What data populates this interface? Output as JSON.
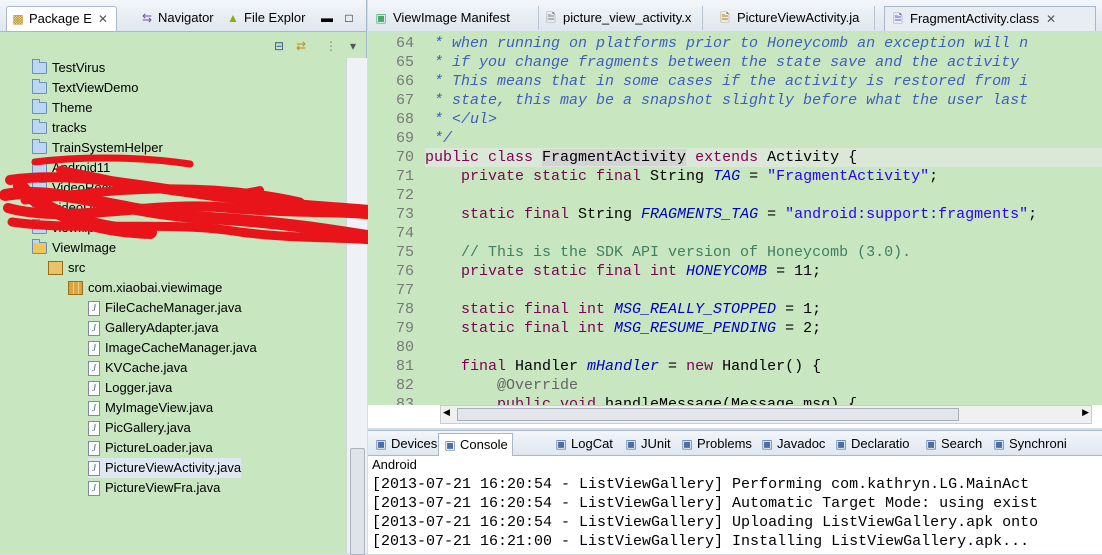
{
  "explorer": {
    "tabs": [
      {
        "label": "Package E",
        "icon": "package-explorer-icon"
      },
      {
        "label": "Navigator",
        "icon": "navigator-icon"
      },
      {
        "label": "File Explor",
        "icon": "android-icon"
      }
    ],
    "tree": [
      {
        "label": "TestVirus",
        "type": "folder",
        "indent": 0
      },
      {
        "label": "TextViewDemo",
        "type": "folder",
        "indent": 0
      },
      {
        "label": "Theme",
        "type": "folder",
        "indent": 0
      },
      {
        "label": "tracks",
        "type": "folder",
        "indent": 0
      },
      {
        "label": "TrainSystemHelper",
        "type": "folder",
        "indent": 0
      },
      {
        "label": "Android11",
        "type": "folder",
        "indent": 0
      },
      {
        "label": "VideoRecoder",
        "type": "folder",
        "indent": 0
      },
      {
        "label": "videoUpload",
        "type": "folder",
        "indent": 0
      },
      {
        "label": "viewflip",
        "type": "folder",
        "indent": 0
      },
      {
        "label": "ViewImage",
        "type": "project",
        "indent": 0
      },
      {
        "label": "src",
        "type": "src",
        "indent": 1
      },
      {
        "label": "com.xiaobai.viewimage",
        "type": "package",
        "indent": 2
      },
      {
        "label": "FileCacheManager.java",
        "type": "java",
        "indent": 3
      },
      {
        "label": "GalleryAdapter.java",
        "type": "java",
        "indent": 3
      },
      {
        "label": "ImageCacheManager.java",
        "type": "java",
        "indent": 3
      },
      {
        "label": "KVCache.java",
        "type": "java",
        "indent": 3
      },
      {
        "label": "Logger.java",
        "type": "java",
        "indent": 3
      },
      {
        "label": "MyImageView.java",
        "type": "java",
        "indent": 3
      },
      {
        "label": "PicGallery.java",
        "type": "java",
        "indent": 3
      },
      {
        "label": "PictureLoader.java",
        "type": "java",
        "indent": 3
      },
      {
        "label": "PictureViewActivity.java",
        "type": "java",
        "indent": 3
      },
      {
        "label": "PictureViewFra.java",
        "type": "java",
        "indent": 3
      }
    ]
  },
  "editor": {
    "tabs": [
      {
        "label": "ViewImage Manifest",
        "icon": "manifest-icon"
      },
      {
        "label": "picture_view_activity.x",
        "icon": "xml-icon"
      },
      {
        "label": "PictureViewActivity.ja",
        "icon": "java-file-icon"
      },
      {
        "label": "FragmentActivity.class",
        "icon": "class-file-icon"
      }
    ],
    "lines": [
      {
        "n": "64",
        "parts": [
          {
            "t": " * when running on platforms prior to Honeycomb an exception will n",
            "c": "cm"
          }
        ]
      },
      {
        "n": "65",
        "parts": [
          {
            "t": " * if you change fragments between the state save and the activity",
            "c": "cm"
          }
        ]
      },
      {
        "n": "66",
        "parts": [
          {
            "t": " * This means that in some cases if the activity is restored from i",
            "c": "cm"
          }
        ]
      },
      {
        "n": "67",
        "parts": [
          {
            "t": " * state, this may be a snapshot slightly before what the user last",
            "c": "cm"
          }
        ]
      },
      {
        "n": "68",
        "parts": [
          {
            "t": " * </ul>",
            "c": "cm"
          }
        ]
      },
      {
        "n": "69",
        "parts": [
          {
            "t": " */",
            "c": "cm"
          }
        ]
      },
      {
        "n": "70",
        "parts": [
          {
            "t": "public class ",
            "c": "kw"
          },
          {
            "t": "FragmentActivity",
            "c": ""
          },
          {
            "t": " extends ",
            "c": "kw"
          },
          {
            "t": "Activity {",
            "c": ""
          }
        ]
      },
      {
        "n": "71",
        "parts": [
          {
            "t": "    private static final ",
            "c": "kw"
          },
          {
            "t": "String ",
            "c": ""
          },
          {
            "t": "TAG",
            "c": "fld"
          },
          {
            "t": " = ",
            "c": ""
          },
          {
            "t": "\"FragmentActivity\"",
            "c": "str"
          },
          {
            "t": ";",
            "c": ""
          }
        ]
      },
      {
        "n": "72",
        "parts": []
      },
      {
        "n": "73",
        "parts": [
          {
            "t": "    static final ",
            "c": "kw"
          },
          {
            "t": "String ",
            "c": ""
          },
          {
            "t": "FRAGMENTS_TAG",
            "c": "fld"
          },
          {
            "t": " = ",
            "c": ""
          },
          {
            "t": "\"android:support:fragments\"",
            "c": "str"
          },
          {
            "t": ";",
            "c": ""
          }
        ]
      },
      {
        "n": "74",
        "parts": []
      },
      {
        "n": "75",
        "parts": [
          {
            "t": "    // This is the SDK API version of Honeycomb (3.0).",
            "c": "cm2"
          }
        ]
      },
      {
        "n": "76",
        "parts": [
          {
            "t": "    private static final int ",
            "c": "kw"
          },
          {
            "t": "HONEYCOMB",
            "c": "fld"
          },
          {
            "t": " = 11;",
            "c": ""
          }
        ]
      },
      {
        "n": "77",
        "parts": []
      },
      {
        "n": "78",
        "parts": [
          {
            "t": "    static final int ",
            "c": "kw"
          },
          {
            "t": "MSG_REALLY_STOPPED",
            "c": "fld"
          },
          {
            "t": " = 1;",
            "c": ""
          }
        ]
      },
      {
        "n": "79",
        "parts": [
          {
            "t": "    static final int ",
            "c": "kw"
          },
          {
            "t": "MSG_RESUME_PENDING",
            "c": "fld"
          },
          {
            "t": " = 2;",
            "c": ""
          }
        ]
      },
      {
        "n": "80",
        "parts": []
      },
      {
        "n": "81",
        "parts": [
          {
            "t": "    final ",
            "c": "kw"
          },
          {
            "t": "Handler ",
            "c": ""
          },
          {
            "t": "mHandler",
            "c": "fld"
          },
          {
            "t": " = ",
            "c": ""
          },
          {
            "t": "new ",
            "c": "kw"
          },
          {
            "t": "Handler() {",
            "c": ""
          }
        ]
      },
      {
        "n": "82",
        "parts": [
          {
            "t": "        @Override",
            "c": "ann"
          }
        ]
      },
      {
        "n": "83",
        "parts": [
          {
            "t": "        public void ",
            "c": "kw"
          },
          {
            "t": "handleMessage(Message msg) {",
            "c": ""
          }
        ]
      }
    ]
  },
  "console": {
    "tabs": [
      {
        "label": "Devices",
        "icon": "devices-icon"
      },
      {
        "label": "Console",
        "icon": "console-icon"
      },
      {
        "label": "LogCat",
        "icon": "logcat-icon"
      },
      {
        "label": "JUnit",
        "icon": "junit-icon"
      },
      {
        "label": "Problems",
        "icon": "problems-icon"
      },
      {
        "label": "Javadoc",
        "icon": "javadoc-icon"
      },
      {
        "label": "Declaratio",
        "icon": "declaration-icon"
      },
      {
        "label": "Search",
        "icon": "search-icon"
      },
      {
        "label": "Synchroni",
        "icon": "synchronize-icon"
      }
    ],
    "label": "Android",
    "lines": [
      "[2013-07-21 16:20:54 - ListViewGallery] Performing com.kathryn.LG.MainAct",
      "[2013-07-21 16:20:54 - ListViewGallery] Automatic Target Mode: using exist",
      "[2013-07-21 16:20:54 - ListViewGallery] Uploading ListViewGallery.apk onto",
      "[2013-07-21 16:21:00 - ListViewGallery] Installing ListViewGallery.apk..."
    ]
  },
  "colors": {
    "editor_bg": "#c8e6c0",
    "keyword": "#7f0055",
    "comment": "#3f5fbf",
    "string": "#2a00ff",
    "field": "#0000c0",
    "scribble": "#e8141a"
  }
}
